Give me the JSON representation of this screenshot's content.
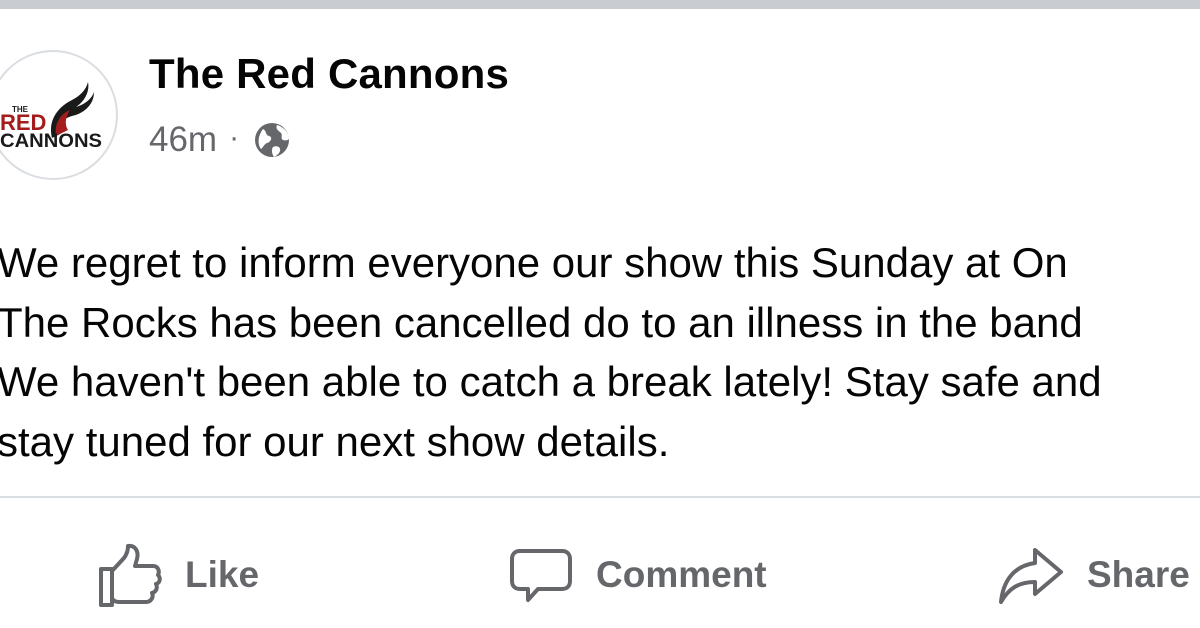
{
  "post": {
    "page_name": "The Red Cannons",
    "timestamp": "46m",
    "separator": "·",
    "audience_icon": "globe-icon",
    "avatar": {
      "logo_small_text": "THE",
      "logo_line1": "RED",
      "logo_line2": "CANNONS",
      "colors": {
        "red": "#a51c1c",
        "dark": "#1a1a1a"
      }
    },
    "text_lines": [
      "We regret to inform everyone our show this Sunday at On",
      "The Rocks has been cancelled do to an illness in the band",
      "We haven't been able to catch a break lately! Stay safe and",
      "stay tuned for our next show details."
    ]
  },
  "actions": {
    "like": {
      "label": "Like",
      "icon": "thumbs-up-icon"
    },
    "comment": {
      "label": "Comment",
      "icon": "comment-bubble-icon"
    },
    "share": {
      "label": "Share",
      "icon": "share-arrow-icon"
    }
  },
  "colors": {
    "text_primary": "#050505",
    "text_secondary": "#65676b",
    "divider": "#dadde1",
    "top_bar": "#c9ccd1"
  }
}
